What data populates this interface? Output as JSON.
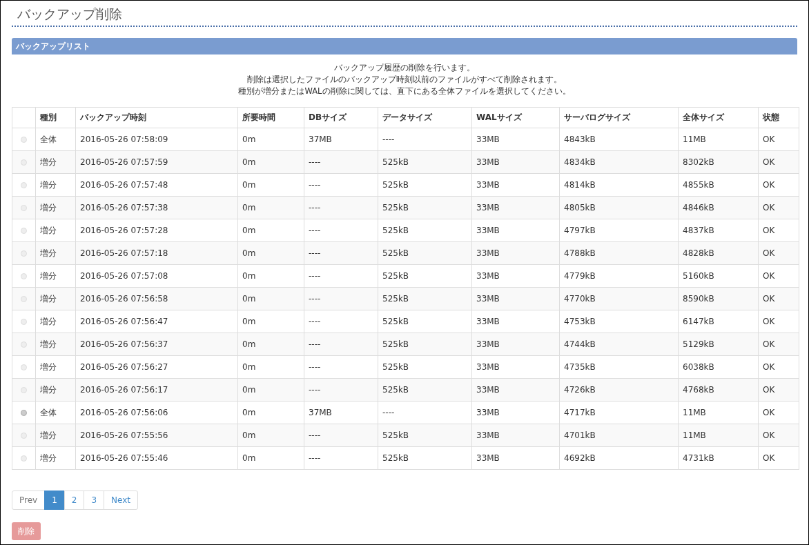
{
  "page_title": "バックアップ削除",
  "panel": {
    "title": "バックアップリスト"
  },
  "description": [
    "バックアップ履歴の削除を行います。",
    "削除は選択したファイルのバックアップ時刻以前のファイルがすべて削除されます。",
    "種別が増分またはWALの削除に関しては、直下にある全体ファイルを選択してください。"
  ],
  "table": {
    "columns": [
      "種別",
      "バックアップ時刻",
      "所要時間",
      "DBサイズ",
      "データサイズ",
      "WALサイズ",
      "サーバログサイズ",
      "全体サイズ",
      "状態"
    ],
    "rows": [
      {
        "selected": false,
        "disabled": true,
        "cells": [
          "全体",
          "2016-05-26 07:58:09",
          "0m",
          "37MB",
          "----",
          "33MB",
          "4843kB",
          "11MB",
          "OK"
        ]
      },
      {
        "selected": false,
        "disabled": true,
        "cells": [
          "増分",
          "2016-05-26 07:57:59",
          "0m",
          "----",
          "525kB",
          "33MB",
          "4834kB",
          "8302kB",
          "OK"
        ]
      },
      {
        "selected": false,
        "disabled": true,
        "cells": [
          "増分",
          "2016-05-26 07:57:48",
          "0m",
          "----",
          "525kB",
          "33MB",
          "4814kB",
          "4855kB",
          "OK"
        ]
      },
      {
        "selected": false,
        "disabled": true,
        "cells": [
          "増分",
          "2016-05-26 07:57:38",
          "0m",
          "----",
          "525kB",
          "33MB",
          "4805kB",
          "4846kB",
          "OK"
        ]
      },
      {
        "selected": false,
        "disabled": true,
        "cells": [
          "増分",
          "2016-05-26 07:57:28",
          "0m",
          "----",
          "525kB",
          "33MB",
          "4797kB",
          "4837kB",
          "OK"
        ]
      },
      {
        "selected": false,
        "disabled": true,
        "cells": [
          "増分",
          "2016-05-26 07:57:18",
          "0m",
          "----",
          "525kB",
          "33MB",
          "4788kB",
          "4828kB",
          "OK"
        ]
      },
      {
        "selected": false,
        "disabled": true,
        "cells": [
          "増分",
          "2016-05-26 07:57:08",
          "0m",
          "----",
          "525kB",
          "33MB",
          "4779kB",
          "5160kB",
          "OK"
        ]
      },
      {
        "selected": false,
        "disabled": true,
        "cells": [
          "増分",
          "2016-05-26 07:56:58",
          "0m",
          "----",
          "525kB",
          "33MB",
          "4770kB",
          "8590kB",
          "OK"
        ]
      },
      {
        "selected": false,
        "disabled": true,
        "cells": [
          "増分",
          "2016-05-26 07:56:47",
          "0m",
          "----",
          "525kB",
          "33MB",
          "4753kB",
          "6147kB",
          "OK"
        ]
      },
      {
        "selected": false,
        "disabled": true,
        "cells": [
          "増分",
          "2016-05-26 07:56:37",
          "0m",
          "----",
          "525kB",
          "33MB",
          "4744kB",
          "5129kB",
          "OK"
        ]
      },
      {
        "selected": false,
        "disabled": true,
        "cells": [
          "増分",
          "2016-05-26 07:56:27",
          "0m",
          "----",
          "525kB",
          "33MB",
          "4735kB",
          "6038kB",
          "OK"
        ]
      },
      {
        "selected": false,
        "disabled": true,
        "cells": [
          "増分",
          "2016-05-26 07:56:17",
          "0m",
          "----",
          "525kB",
          "33MB",
          "4726kB",
          "4768kB",
          "OK"
        ]
      },
      {
        "selected": false,
        "disabled": false,
        "cells": [
          "全体",
          "2016-05-26 07:56:06",
          "0m",
          "37MB",
          "----",
          "33MB",
          "4717kB",
          "11MB",
          "OK"
        ]
      },
      {
        "selected": false,
        "disabled": true,
        "cells": [
          "増分",
          "2016-05-26 07:55:56",
          "0m",
          "----",
          "525kB",
          "33MB",
          "4701kB",
          "11MB",
          "OK"
        ]
      },
      {
        "selected": false,
        "disabled": true,
        "cells": [
          "増分",
          "2016-05-26 07:55:46",
          "0m",
          "----",
          "525kB",
          "33MB",
          "4692kB",
          "4731kB",
          "OK"
        ]
      }
    ]
  },
  "pagination": [
    {
      "label": "Prev",
      "selected": false,
      "disabled": true
    },
    {
      "label": "1",
      "selected": true,
      "disabled": false
    },
    {
      "label": "2",
      "selected": false,
      "disabled": false
    },
    {
      "label": "3",
      "selected": false,
      "disabled": false
    },
    {
      "label": "Next",
      "selected": false,
      "disabled": false
    }
  ],
  "delete_button": {
    "label": "削除",
    "disabled": true
  }
}
